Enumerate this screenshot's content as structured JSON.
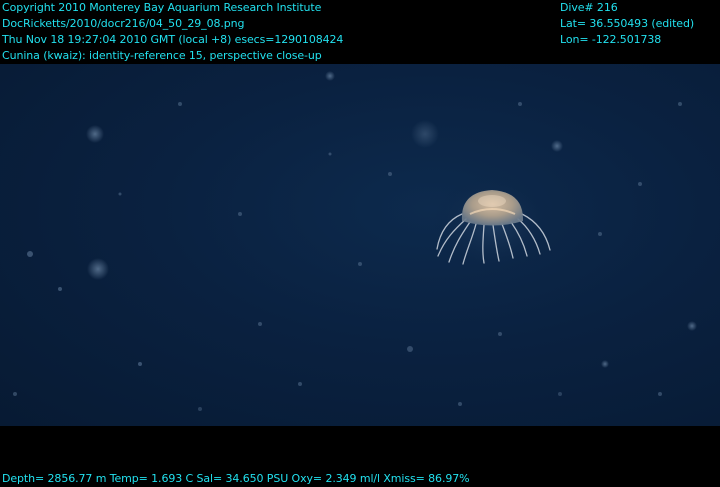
{
  "header": {
    "left_lines": [
      "Copyright 2010 Monterey Bay Aquarium Research Institute",
      "DocRicketts/2010/docr216/04_50_29_08.png",
      "Thu Nov 18 19:27:04 2010 GMT (local +8)  esecs=1290108424",
      "Cunina (kwaiz): identity-reference 15, perspective close-up"
    ],
    "right_lines": [
      "Dive# 216",
      "Lat= 36.550493 (edited)",
      "Lon= -122.501738"
    ]
  },
  "footer": {
    "text": "Depth= 2856.77 m  Temp= 1.693 C  Sal= 34.650 PSU  Oxy= 2.349 ml/l  Xmiss= 86.97%"
  },
  "scene": {
    "subject": "jellyfish-icon",
    "colors": {
      "water": "#0a2140",
      "overlay_text": "#22e0ee"
    }
  }
}
